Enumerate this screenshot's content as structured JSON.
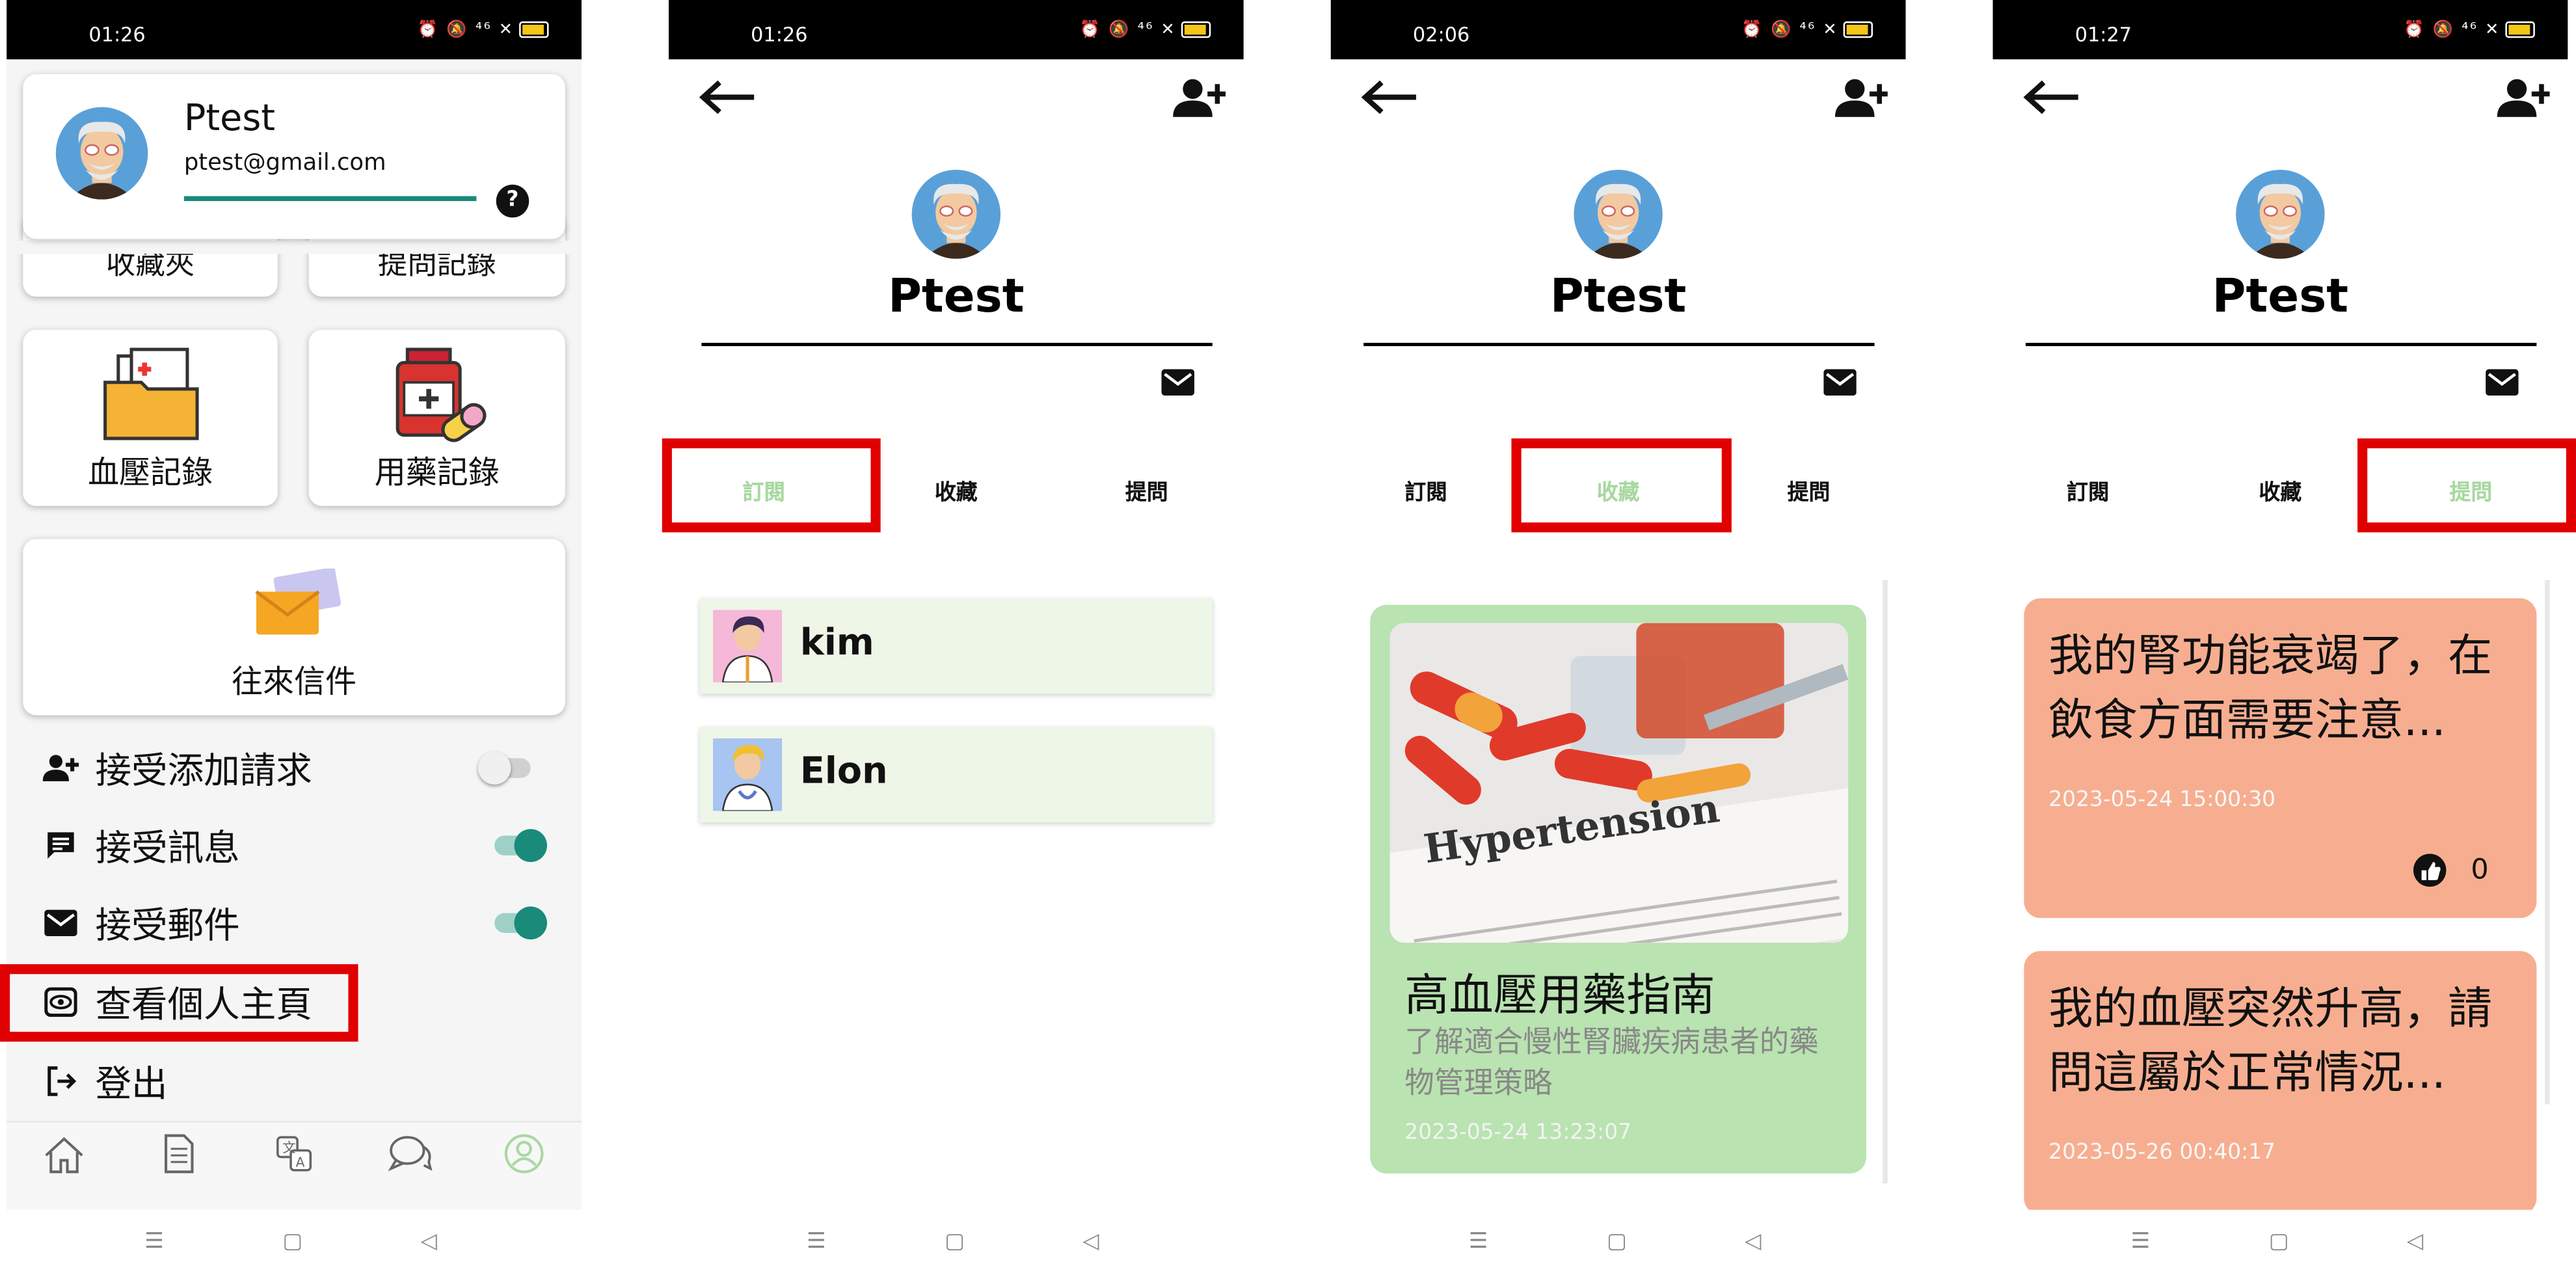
{
  "status_bars": [
    {
      "time": "01:26"
    },
    {
      "time": "01:26"
    },
    {
      "time": "02:06"
    },
    {
      "time": "01:27"
    }
  ],
  "profile": {
    "name": "Ptest",
    "email": "ptest@gmail.com",
    "help": "?"
  },
  "settings_screen": {
    "tile_partial_left": "收藏夾",
    "tile_partial_right": "提問記錄",
    "tile_bp": "血壓記錄",
    "tile_med": "用藥記錄",
    "tile_mail": "往來信件",
    "menu": [
      {
        "label": "接受添加請求",
        "toggle": false
      },
      {
        "label": "接受訊息",
        "toggle": true
      },
      {
        "label": "接受郵件",
        "toggle": true
      },
      {
        "label": "查看個人主頁"
      },
      {
        "label": "登出"
      }
    ]
  },
  "profile_page": {
    "name": "Ptest",
    "tabs": [
      "訂閱",
      "收藏",
      "提問"
    ]
  },
  "subscriptions": [
    {
      "name": "kim"
    },
    {
      "name": "Elon"
    }
  ],
  "favorite": {
    "image_text": "Hypertension",
    "title": "高血壓用藥指南",
    "desc": "了解適合慢性腎臟疾病患者的藥物管理策略",
    "date": "2023-05-24 13:23:07"
  },
  "questions": [
    {
      "text": "我的腎功能衰竭了，在飲食方面需要注意...",
      "date": "2023-05-24 15:00:30",
      "likes": "0"
    },
    {
      "text": "我的血壓突然升高，請問這屬於正常情況...",
      "date": "2023-05-26 00:40:17"
    }
  ],
  "colors": {
    "accent": "#1a8a7a",
    "highlight": "#e00000",
    "active_tab": "#a8d8a0",
    "sub_bg": "#eef6e8",
    "fav_bg": "#b9e3b0",
    "q_bg": "#f7ae90"
  }
}
